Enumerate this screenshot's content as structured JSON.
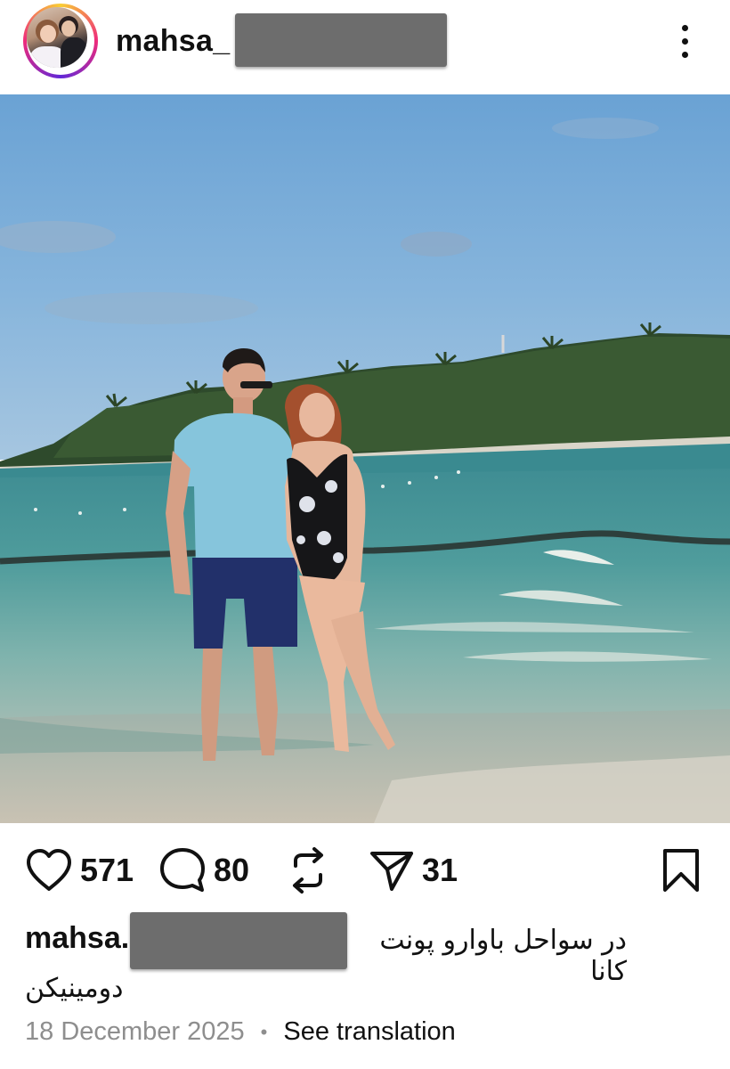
{
  "post": {
    "username_visible": "mahsa_",
    "avatar_icon": "profile-avatar",
    "menu_icon": "more-vertical-icon",
    "photo_description_alt": "",
    "actions": {
      "likes": "571",
      "comments": "80",
      "reposts": "",
      "shares": "31"
    },
    "icons": {
      "like": "heart-icon",
      "comment": "comment-bubble-icon",
      "repost": "repost-icon",
      "share": "send-icon",
      "save": "bookmark-icon"
    },
    "caption": {
      "username_visible": "mahsa.",
      "text_line1": "در سواحل باوارو پونت کانا",
      "text_line2": "دومینیکن"
    },
    "date": "18 December 2025",
    "separator": "•",
    "translation_link": "See translation"
  },
  "colors": {
    "text": "#111111",
    "muted": "#8e8e8e",
    "redaction": "#6d6d6d",
    "ring_gradient": [
      "#f9ce34",
      "#ee2a7b",
      "#6228d7"
    ]
  }
}
